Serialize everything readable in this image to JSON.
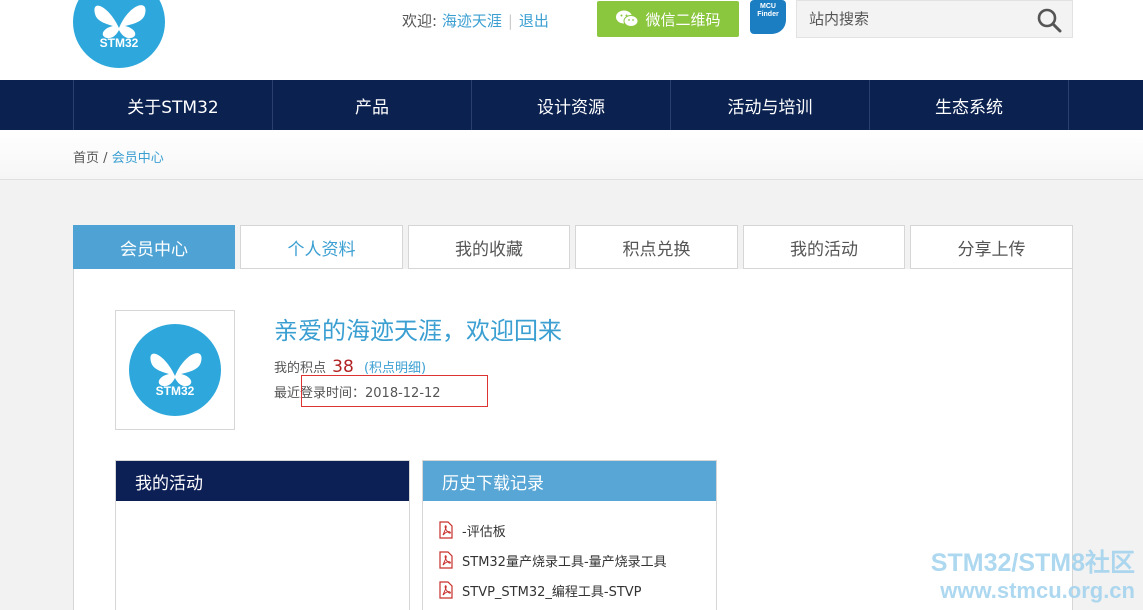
{
  "header": {
    "logo_text": "STM32",
    "welcome_label": "欢迎:",
    "username": "海迹天涯",
    "logout": "退出",
    "wechat_button": "微信二维码",
    "mcu_finder_line1": "MCU",
    "mcu_finder_line2": "Finder",
    "search_placeholder": "站内搜索"
  },
  "nav": {
    "items": [
      "关于STM32",
      "产品",
      "设计资源",
      "活动与培训",
      "生态系统"
    ]
  },
  "breadcrumb": {
    "home": "首页",
    "separator": "/",
    "current": "会员中心"
  },
  "tabs": [
    "会员中心",
    "个人资料",
    "我的收藏",
    "积点兑换",
    "我的活动",
    "分享上传"
  ],
  "profile": {
    "avatar_text": "STM32",
    "greeting": "亲爱的海迹天涯，欢迎回来",
    "points_label": "我的积点",
    "points_value": "38",
    "points_detail": "(积点明细)",
    "last_login": "最近登录时间：2018-12-12"
  },
  "activity_box": {
    "title": "我的活动"
  },
  "history_box": {
    "title": "历史下载记录",
    "items": [
      "-评估板",
      "STM32量产烧录工具-量产烧录工具",
      "STVP_STM32_编程工具-STVP"
    ]
  },
  "watermark": {
    "line1": "STM32/STM8社区",
    "line2": "www.stmcu.org.cn"
  },
  "colors": {
    "nav_bg": "#0b2150",
    "accent_blue": "#3b9fd2",
    "tab_active": "#4fa3d4",
    "wechat_green": "#8bc63f",
    "points_red": "#b22222"
  }
}
